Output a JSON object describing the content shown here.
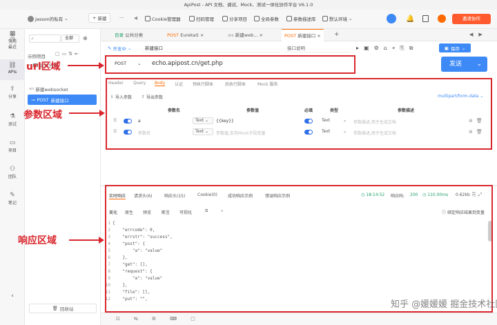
{
  "window": {
    "title": "ApiPost - API 文档、调试、Mock、测试一体化协作平台 V6.1.0"
  },
  "toolbar": {
    "workspace": "Jasson的私有",
    "new_label": "新建",
    "more": "···",
    "items": [
      "Cookie管理器",
      "扫码管理",
      "分享项目",
      "全局参数",
      "参数描述库",
      "默认环境"
    ],
    "invite_label": "邀请协作",
    "accent": "#ff6a00"
  },
  "rail": {
    "items": [
      {
        "label": "常用",
        "icon": "grid-icon"
      },
      {
        "label": "最近",
        "icon": "clock-icon"
      },
      {
        "label": "APIs",
        "icon": "link-icon"
      },
      {
        "label": "分享",
        "icon": "share-icon"
      },
      {
        "label": "测试",
        "icon": "test-icon"
      },
      {
        "label": "项目",
        "icon": "folder-icon"
      },
      {
        "label": "团队",
        "icon": "team-icon"
      },
      {
        "label": "笔记",
        "icon": "note-icon"
      }
    ]
  },
  "tree": {
    "filter": "全部",
    "search_placeholder": "",
    "section": "示例项目",
    "items": [
      {
        "label": "公共分类"
      },
      {
        "label": "新建websocket",
        "method": "ws"
      },
      {
        "label": "新建接口",
        "method": "POST"
      }
    ],
    "recycle": "回收站"
  },
  "tabs": [
    {
      "prefix": "目录",
      "label": "公共分类"
    },
    {
      "prefix": "POST",
      "label": "EurekaS"
    },
    {
      "prefix": "ws",
      "label": "新建web..."
    },
    {
      "prefix": "POST",
      "label": "新建接口"
    }
  ],
  "env": {
    "status": "开发中",
    "name": "新建接口",
    "desc_placeholder": "接口说明",
    "save": "保存"
  },
  "url": {
    "method": "POST",
    "value": "echo.apipost.cn/get.php",
    "send": "发送"
  },
  "annotations": {
    "url": "url区域",
    "params": "参数区域",
    "response": "响应区域"
  },
  "params": {
    "tabs": [
      "Header",
      "Query",
      "Body",
      "认证",
      "预执行脚本",
      "后执行脚本",
      "Mock 服务"
    ],
    "import": "导入参数",
    "export": "导出参数",
    "body_type": "multipart/form-data",
    "headers": [
      "参数名",
      "参数值",
      "必填",
      "类型",
      "参数描述"
    ],
    "rows": [
      {
        "name": "a",
        "type_sel": "Text",
        "value": "{{key}}",
        "type": "Text",
        "desc": "参数描述,用于生成文档"
      },
      {
        "name": "参数名",
        "type_sel": "Text",
        "value": "参数值,支持Mock字段变量",
        "type": "Text",
        "desc": "参数描述,用于生成文档"
      }
    ]
  },
  "response": {
    "tabs": [
      "实时响应",
      "请求头(6)",
      "响应头(15)",
      "Cookie(0)",
      "成功响应示例",
      "错误响应示例"
    ],
    "time": "18:14:52",
    "code_label": "响应码:",
    "code": "200",
    "duration": "110.00ms",
    "size": "0.62kb",
    "views": [
      "美化",
      "原生",
      "预览",
      "断言",
      "可视化"
    ],
    "bind_label": "绑定响应结果到变量",
    "lines": [
      "{",
      "    \"errcode\": 0,",
      "    \"errstr\": \"success\",",
      "    \"post\": {",
      "        \"a\": \"value\"",
      "    },",
      "    \"get\": [],",
      "    \"request\": {",
      "        \"a\": \"value\"",
      "    },",
      "    \"file\": [],",
      "    \"put\": \"\","
    ],
    "line_numbers": [
      "1",
      "2",
      "3",
      "4",
      "5",
      "6",
      "7",
      "8",
      "9",
      "10",
      "11",
      "12"
    ]
  },
  "watermark": "知乎 @媛媛媛 掘金技术社区"
}
